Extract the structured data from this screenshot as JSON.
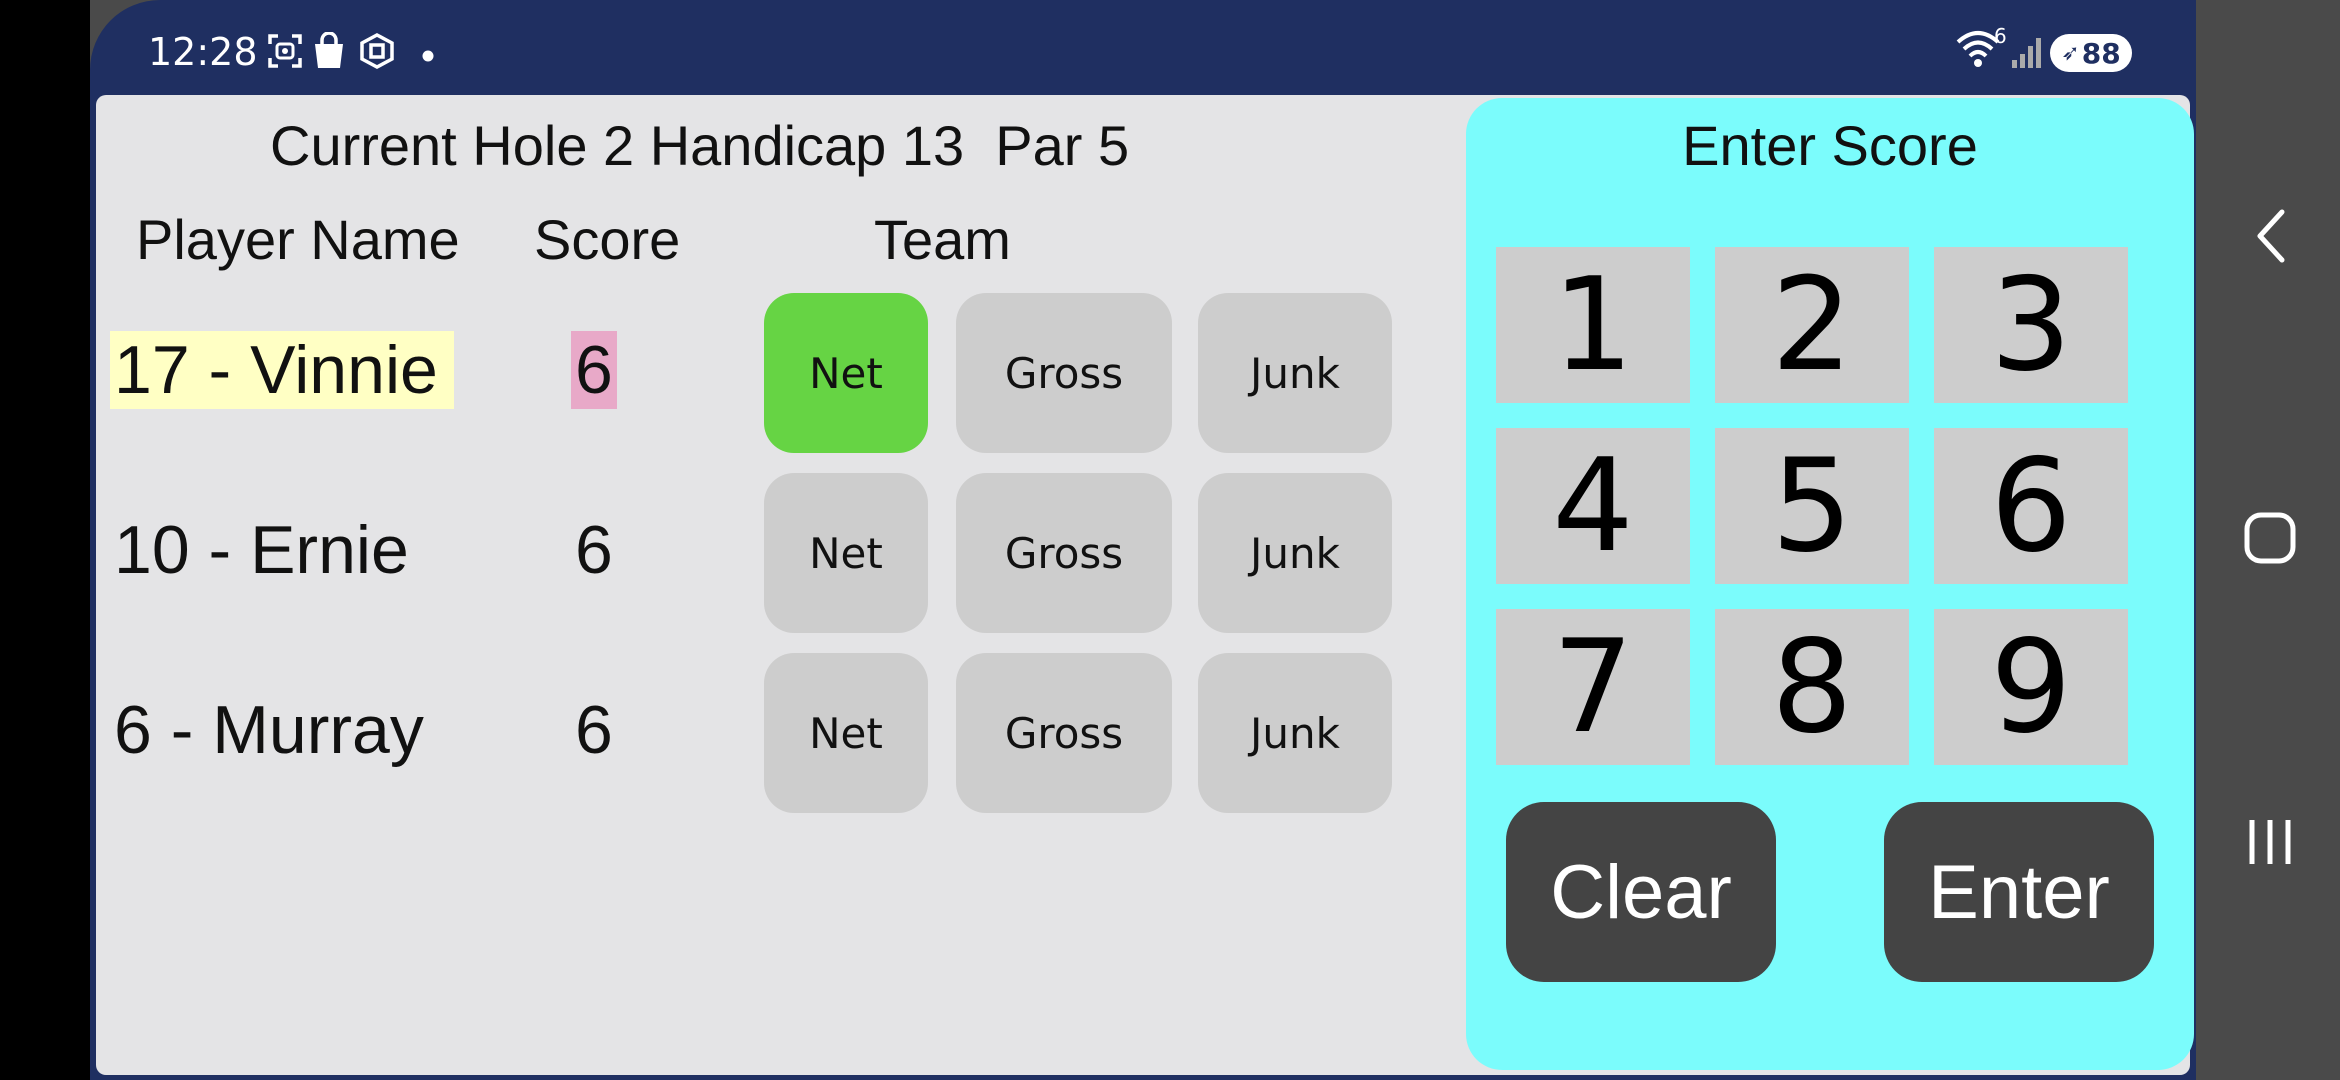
{
  "status_bar": {
    "time": "12:28",
    "icons": [
      "screenshot-icon",
      "shopping-bag-icon",
      "store-icon",
      "notification-dot-icon"
    ],
    "wifi_badge": "6",
    "battery_level": "88"
  },
  "header": {
    "hole_info": "Current Hole 2 Handicap 13  Par 5"
  },
  "columns": {
    "player_name": "Player Name",
    "score": "Score",
    "team": "Team"
  },
  "players": [
    {
      "name": "17 - Vinnie",
      "score": "6",
      "highlight_name": "#ffffc4",
      "highlight_score": "#e8a9c8",
      "team_buttons": [
        "Net",
        "Gross",
        "Junk"
      ],
      "active_team": "Net"
    },
    {
      "name": "10 - Ernie",
      "score": "6",
      "team_buttons": [
        "Net",
        "Gross",
        "Junk"
      ],
      "active_team": ""
    },
    {
      "name": "6 - Murray",
      "score": "6",
      "team_buttons": [
        "Net",
        "Gross",
        "Junk"
      ],
      "active_team": ""
    }
  ],
  "keypad": {
    "title": "Enter Score",
    "keys": [
      "1",
      "2",
      "3",
      "4",
      "5",
      "6",
      "7",
      "8",
      "9"
    ],
    "clear_label": "Clear",
    "enter_label": "Enter"
  },
  "colors": {
    "status_bar_bg": "#1f2f61",
    "app_bg": "#e4e4e6",
    "keypad_bg": "#7bfcfc",
    "key_bg": "#cdcdcd",
    "active_team_bg": "#66d444",
    "action_btn_bg": "#444444"
  },
  "nav_bar": {
    "icons": [
      "back-icon",
      "home-icon",
      "recents-icon"
    ]
  }
}
